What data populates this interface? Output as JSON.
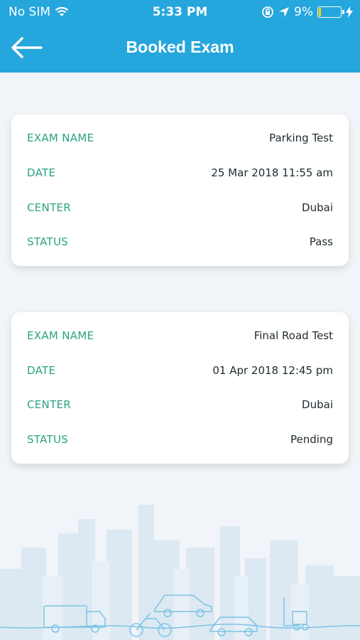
{
  "status_bar": {
    "carrier": "No SIM",
    "time": "5:33 PM",
    "battery": "9%"
  },
  "header": {
    "title": "Booked Exam"
  },
  "exams": [
    {
      "name_label": "EXAM NAME",
      "name": "Parking Test",
      "date_label": "DATE",
      "date": "25 Mar 2018 11:55 am",
      "center_label": "CENTER",
      "center": "Dubai",
      "status_label": "STATUS",
      "status": "Pass"
    },
    {
      "name_label": "EXAM NAME",
      "name": "Final Road Test",
      "date_label": "DATE",
      "date": "01 Apr 2018 12:45 pm",
      "center_label": "CENTER",
      "center": "Dubai",
      "status_label": "STATUS",
      "status": "Pending"
    }
  ],
  "colors": {
    "header": "#25a6dc",
    "label": "#2aa383",
    "background": "#f1f4f8"
  }
}
